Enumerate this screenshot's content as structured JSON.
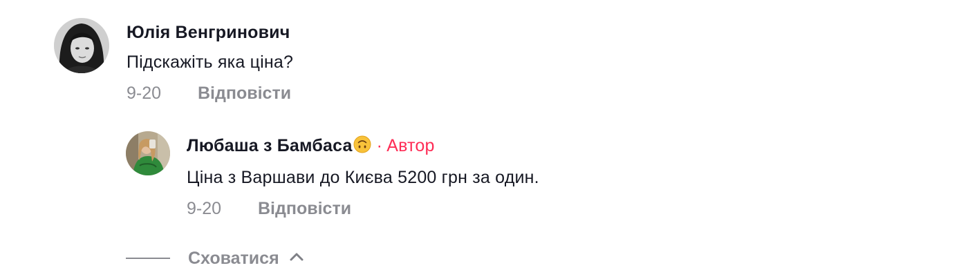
{
  "comments": [
    {
      "author": "Юлія Венгринович",
      "text": "Підскажіть яка ціна?",
      "date": "9-20",
      "reply_label": "Відповісти",
      "avatar": "avatar-photo"
    }
  ],
  "reply": {
    "author": "Любаша з Бамбаса",
    "author_emoji": "upside-down-face-emoji",
    "separator": "·",
    "badge": "Автор",
    "text": "Ціна з Варшави до Києва 5200 грн за один.",
    "date": "9-20",
    "reply_label": "Відповісти",
    "avatar": "avatar-photo"
  },
  "hide_replies": {
    "label": "Сховатися",
    "icon": "chevron-up-icon"
  },
  "colors": {
    "accent": "#fe2c55",
    "text": "#161823",
    "muted": "rgba(22,24,35,0.5)"
  }
}
